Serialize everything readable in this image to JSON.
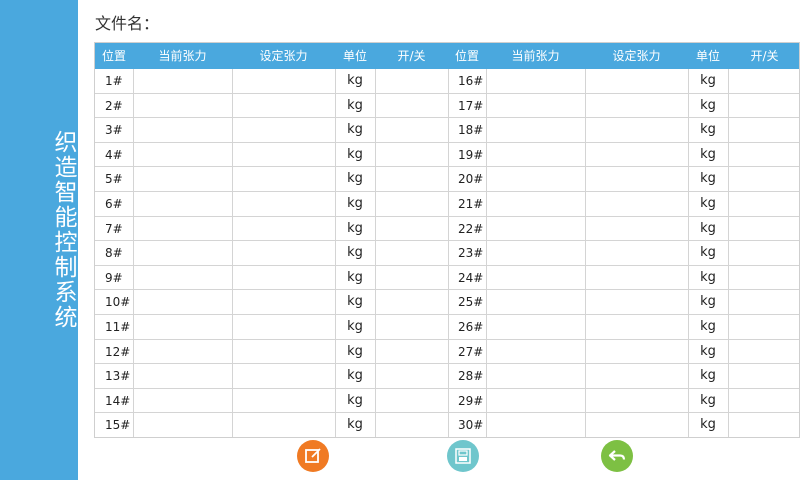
{
  "sidebar": {
    "title": "织造智能控制系统"
  },
  "file_label": "文件名：",
  "headers": [
    "位置",
    "当前张力",
    "设定张力",
    "单位",
    "开/关"
  ],
  "left_rows": [
    {
      "pos": "1#",
      "unit": "kg"
    },
    {
      "pos": "2#",
      "unit": "kg"
    },
    {
      "pos": "3#",
      "unit": "kg"
    },
    {
      "pos": "4#",
      "unit": "kg"
    },
    {
      "pos": "5#",
      "unit": "kg"
    },
    {
      "pos": "6#",
      "unit": "kg"
    },
    {
      "pos": "7#",
      "unit": "kg"
    },
    {
      "pos": "8#",
      "unit": "kg"
    },
    {
      "pos": "9#",
      "unit": "kg"
    },
    {
      "pos": "10#",
      "unit": "kg"
    },
    {
      "pos": "11#",
      "unit": "kg"
    },
    {
      "pos": "12#",
      "unit": "kg"
    },
    {
      "pos": "13#",
      "unit": "kg"
    },
    {
      "pos": "14#",
      "unit": "kg"
    },
    {
      "pos": "15#",
      "unit": "kg"
    }
  ],
  "right_rows": [
    {
      "pos": "16#",
      "unit": "kg"
    },
    {
      "pos": "17#",
      "unit": "kg"
    },
    {
      "pos": "18#",
      "unit": "kg"
    },
    {
      "pos": "19#",
      "unit": "kg"
    },
    {
      "pos": "20#",
      "unit": "kg"
    },
    {
      "pos": "21#",
      "unit": "kg"
    },
    {
      "pos": "22#",
      "unit": "kg"
    },
    {
      "pos": "23#",
      "unit": "kg"
    },
    {
      "pos": "24#",
      "unit": "kg"
    },
    {
      "pos": "25#",
      "unit": "kg"
    },
    {
      "pos": "26#",
      "unit": "kg"
    },
    {
      "pos": "27#",
      "unit": "kg"
    },
    {
      "pos": "28#",
      "unit": "kg"
    },
    {
      "pos": "29#",
      "unit": "kg"
    },
    {
      "pos": "30#",
      "unit": "kg"
    }
  ],
  "buttons": [
    {
      "name": "edit-button",
      "icon": "edit-icon",
      "color": "#f07a23"
    },
    {
      "name": "save-button",
      "icon": "save-icon",
      "color": "#6fc6cc"
    },
    {
      "name": "back-button",
      "icon": "back-arrow-icon",
      "color": "#7dc043"
    }
  ]
}
